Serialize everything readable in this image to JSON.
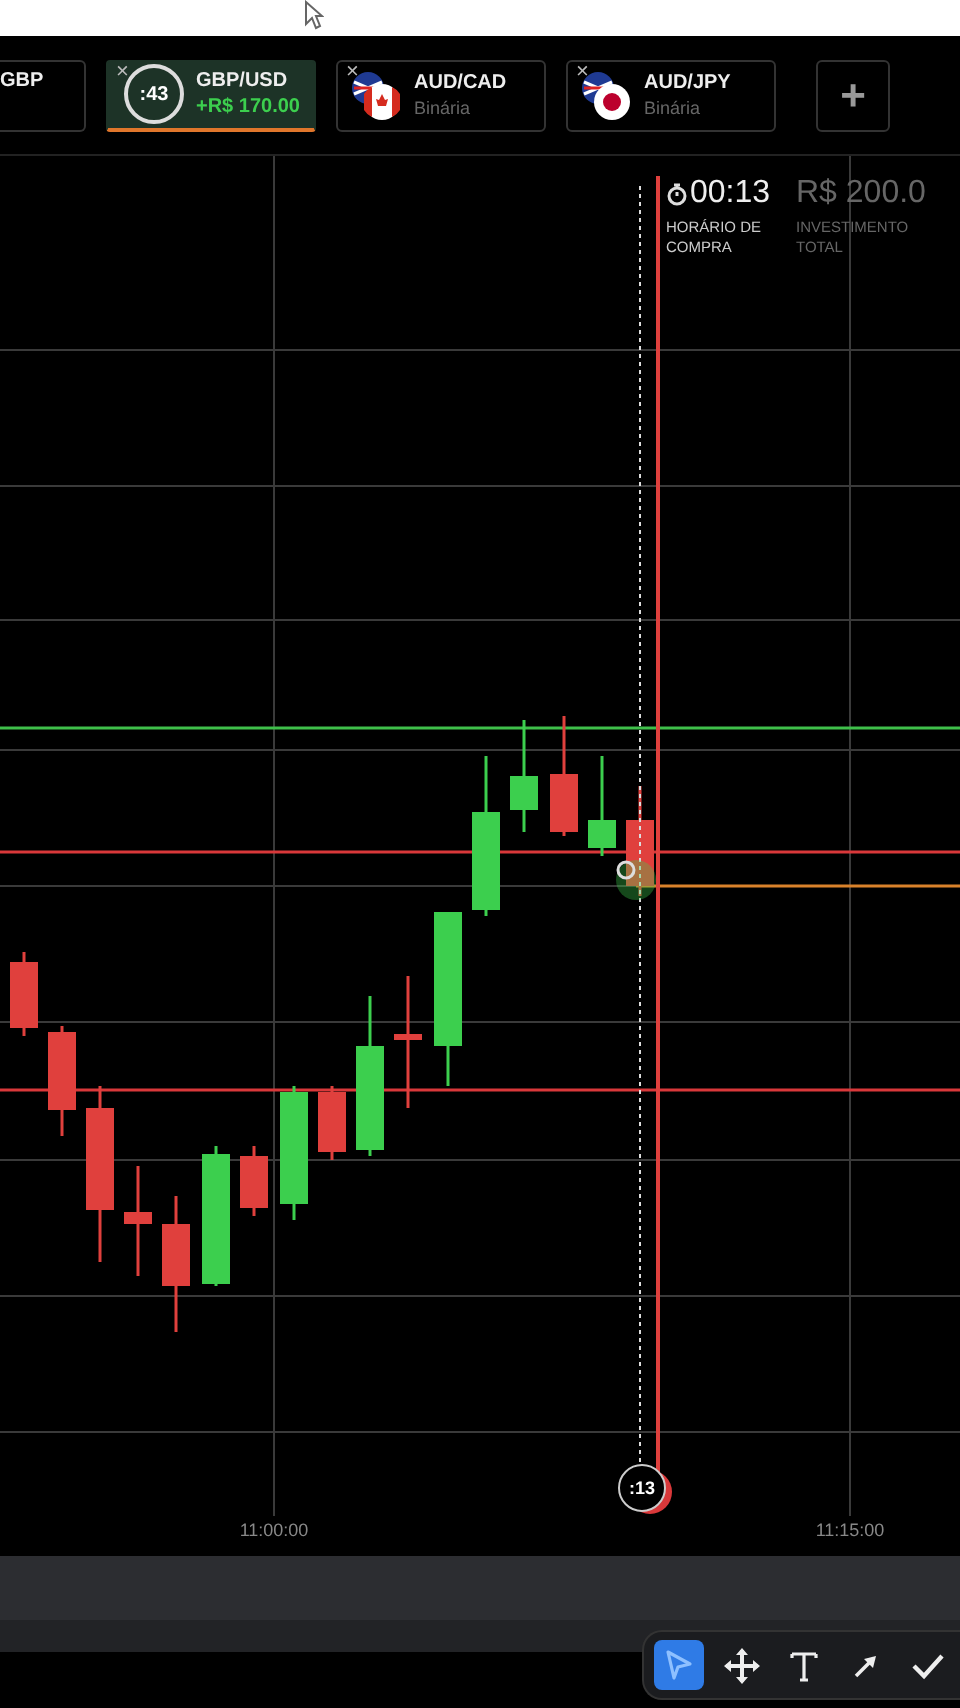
{
  "tabs": [
    {
      "kind": "partial",
      "title": "GBP",
      "selected": false
    },
    {
      "kind": "timer",
      "title": "GBP/USD",
      "subtitle": "+R$ 170.00",
      "timer": ":43",
      "close": "×",
      "selected": true
    },
    {
      "kind": "canada",
      "title": "AUD/CAD",
      "subtitle": "Binária",
      "close": "×",
      "selected": false
    },
    {
      "kind": "japan",
      "title": "AUD/JPY",
      "subtitle": "Binária",
      "close": "×",
      "selected": false
    }
  ],
  "add_button": "+",
  "info": {
    "timer": "00:13",
    "timer_label": "HORÁRIO DE COMPRA",
    "amount": "R$ 200.0",
    "amount_label": "INVESTIMENTO TOTAL"
  },
  "time_labels": [
    "11:00:00",
    "11:15:00"
  ],
  "expiry_badge": ":13",
  "tools": [
    {
      "kind": "pointer",
      "selected": true
    },
    {
      "kind": "move",
      "selected": false
    },
    {
      "kind": "text",
      "selected": false
    },
    {
      "kind": "arrow",
      "selected": false
    },
    {
      "kind": "check",
      "selected": false
    }
  ]
}
